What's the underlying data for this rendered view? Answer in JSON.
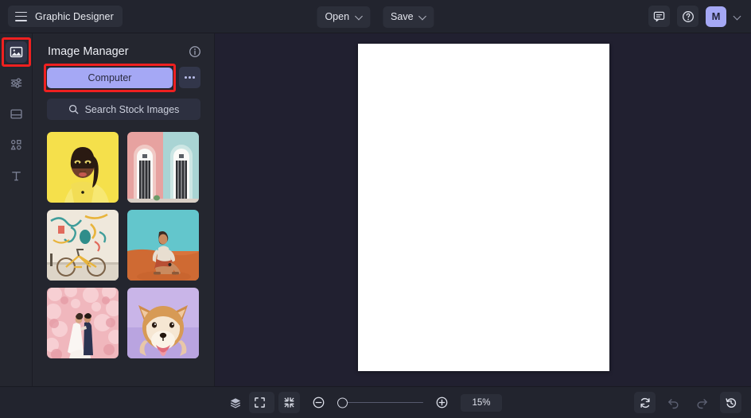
{
  "header": {
    "menu_icon": "hamburger-icon",
    "app_title": "Graphic Designer",
    "open_label": "Open",
    "save_label": "Save",
    "comment_icon": "comment-icon",
    "help_icon": "help-circle-icon",
    "avatar_initial": "M",
    "avatar_color": "#a5a8f5"
  },
  "rail": {
    "items": [
      {
        "name": "image-manager",
        "icon": "image-icon",
        "active": true,
        "highlighted": true
      },
      {
        "name": "adjustments",
        "icon": "sliders-icon",
        "active": false,
        "highlighted": false
      },
      {
        "name": "layouts",
        "icon": "layout-frame-icon",
        "active": false,
        "highlighted": false
      },
      {
        "name": "shapes",
        "icon": "shapes-icon",
        "active": false,
        "highlighted": false
      },
      {
        "name": "text",
        "icon": "text-t-icon",
        "active": false,
        "highlighted": false
      }
    ]
  },
  "panel": {
    "title": "Image Manager",
    "info_icon": "info-circle-icon",
    "computer_label": "Computer",
    "computer_highlighted": true,
    "more_icon": "more-horizontal-icon",
    "search_icon": "search-icon",
    "search_label": "Search Stock Images",
    "thumbnails": [
      {
        "name": "portrait-woman-yellow",
        "caption": "Woman in yellow shirt on yellow background"
      },
      {
        "name": "pastel-doors",
        "caption": "Pink and teal pastel doorways"
      },
      {
        "name": "bicycle-mural",
        "caption": "Bicycle against painted mural wall"
      },
      {
        "name": "man-desert",
        "caption": "Man sitting on orange desert sand"
      },
      {
        "name": "wedding-blossoms",
        "caption": "Wedding couple among pink blossoms"
      },
      {
        "name": "shiba-dog",
        "caption": "Shiba Inu dog on purple background"
      }
    ]
  },
  "canvas": {
    "document_color": "#ffffff"
  },
  "footer": {
    "layers_icon": "layers-icon",
    "grid_icon": "grid-icon",
    "fit_screen_icon": "fit-screen-icon",
    "shrink_icon": "shrink-icon",
    "zoom_out_icon": "zoom-out-icon",
    "zoom_in_icon": "zoom-in-icon",
    "zoom_level": "15%",
    "slider_position_percent": 0,
    "refresh_icon": "refresh-icon",
    "undo_icon": "undo-icon",
    "redo_icon": "redo-icon",
    "history_icon": "history-icon"
  }
}
